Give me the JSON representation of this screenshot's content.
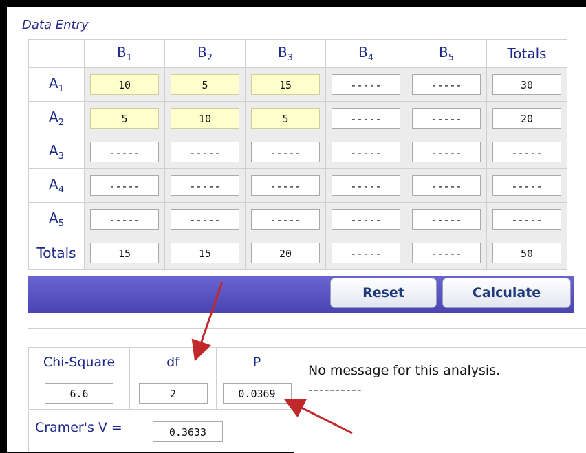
{
  "section_title": "Data Entry",
  "columns": [
    {
      "letter": "B",
      "sub": "1"
    },
    {
      "letter": "B",
      "sub": "2"
    },
    {
      "letter": "B",
      "sub": "3"
    },
    {
      "letter": "B",
      "sub": "4"
    },
    {
      "letter": "B",
      "sub": "5"
    }
  ],
  "totals_label": "Totals",
  "rows": [
    {
      "letter": "A",
      "sub": "1",
      "cells": [
        "10",
        "5",
        "15",
        "-----",
        "-----"
      ],
      "total": "30"
    },
    {
      "letter": "A",
      "sub": "2",
      "cells": [
        "5",
        "10",
        "5",
        "-----",
        "-----"
      ],
      "total": "20"
    },
    {
      "letter": "A",
      "sub": "3",
      "cells": [
        "-----",
        "-----",
        "-----",
        "-----",
        "-----"
      ],
      "total": "-----"
    },
    {
      "letter": "A",
      "sub": "4",
      "cells": [
        "-----",
        "-----",
        "-----",
        "-----",
        "-----"
      ],
      "total": "-----"
    },
    {
      "letter": "A",
      "sub": "5",
      "cells": [
        "-----",
        "-----",
        "-----",
        "-----",
        "-----"
      ],
      "total": "-----"
    }
  ],
  "column_totals": [
    "15",
    "15",
    "20",
    "-----",
    "-----"
  ],
  "grand_total": "50",
  "buttons": {
    "reset": "Reset",
    "calculate": "Calculate"
  },
  "results": {
    "chi_label": "Chi-Square",
    "df_label": "df",
    "p_label": "P",
    "chi_value": "6.6",
    "df_value": "2",
    "p_value": "0.0369",
    "cramer_label": "Cramer's V =",
    "cramer_value": "0.3633"
  },
  "message": {
    "text": "No message for this analysis.",
    "dashes": "----------"
  },
  "colors": {
    "filled_cell": "#ffffcc",
    "bar": "#5a55c2",
    "arrow": "#c0282a"
  }
}
